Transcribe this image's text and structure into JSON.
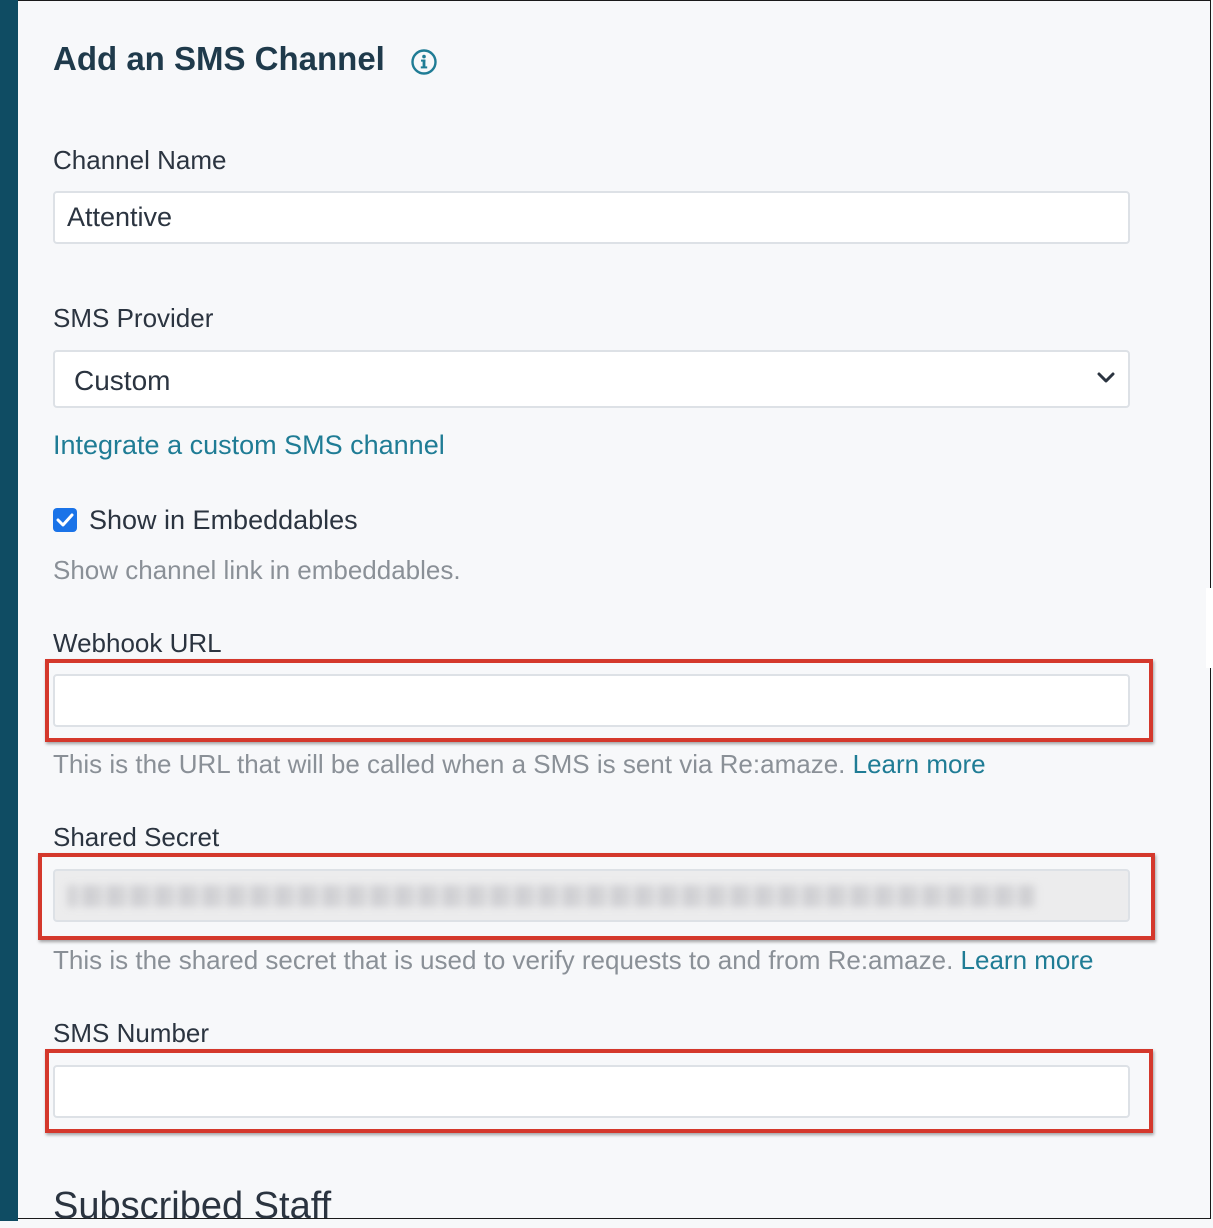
{
  "header": {
    "title": "Add an SMS Channel",
    "info_icon": "info-circle-icon"
  },
  "colors": {
    "accent": "#1f7c95",
    "title": "#1f3a4b",
    "left_bar": "#0f4c63",
    "highlight": "#d4382c",
    "checkbox": "#1a73e8"
  },
  "form": {
    "channel_name": {
      "label": "Channel Name",
      "value": "Attentive"
    },
    "sms_provider": {
      "label": "SMS Provider",
      "selected": "Custom",
      "link": "Integrate a custom SMS channel"
    },
    "show_in_embeddables": {
      "label": "Show in Embeddables",
      "checked": true,
      "help": "Show channel link in embeddables."
    },
    "webhook_url": {
      "label": "Webhook URL",
      "value": "",
      "help": "This is the URL that will be called when a SMS is sent via Re:amaze.",
      "learn_more": "Learn more"
    },
    "shared_secret": {
      "label": "Shared Secret",
      "help": "This is the shared secret that is used to verify requests to and from Re:amaze.",
      "learn_more": "Learn more"
    },
    "sms_number": {
      "label": "SMS Number",
      "value": ""
    }
  },
  "sections": {
    "subscribed_staff": "Subscribed Staff"
  }
}
